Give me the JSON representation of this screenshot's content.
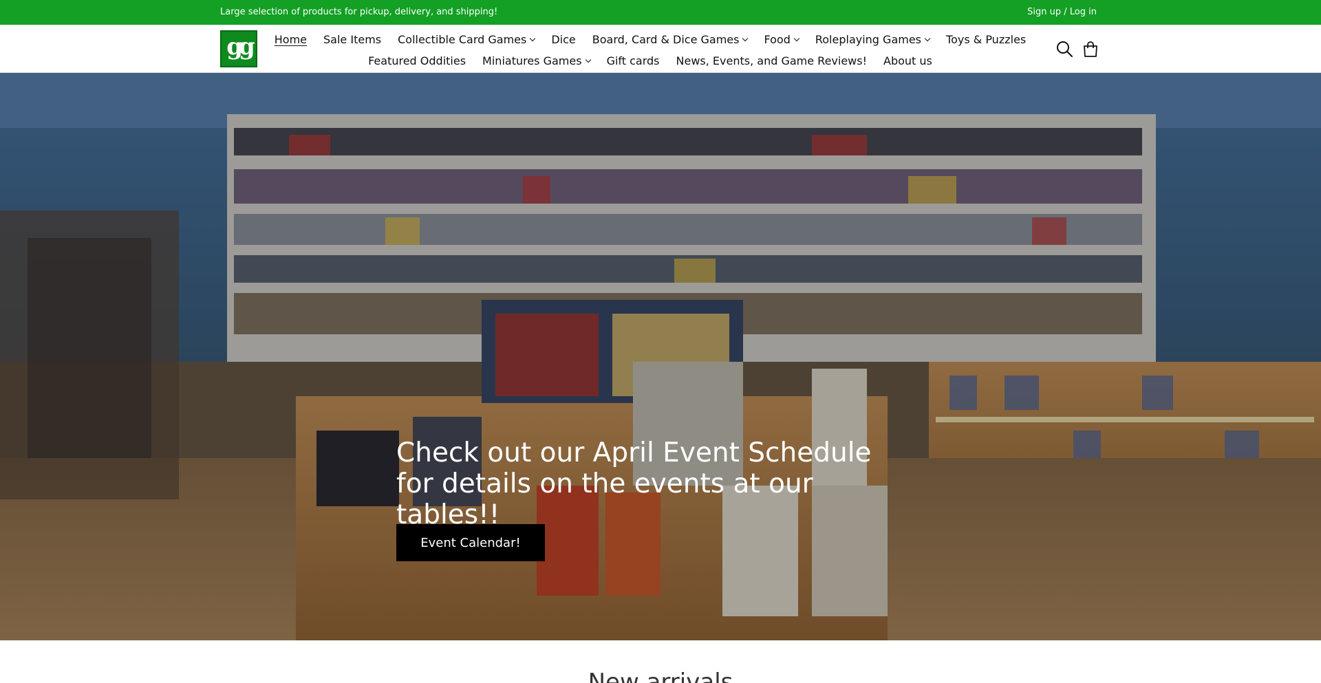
{
  "announcement": {
    "text": "Large selection of products for pickup, delivery, and shipping!",
    "account_link": "Sign up / Log in"
  },
  "logo": {
    "mark": "gg"
  },
  "nav": {
    "row1": [
      {
        "label": "Home",
        "dropdown": false,
        "active": true
      },
      {
        "label": "Sale Items",
        "dropdown": false
      },
      {
        "label": "Collectible Card Games",
        "dropdown": true
      },
      {
        "label": "Dice",
        "dropdown": false
      },
      {
        "label": "Board, Card & Dice Games",
        "dropdown": true
      },
      {
        "label": "Food",
        "dropdown": true
      },
      {
        "label": "Roleplaying Games",
        "dropdown": true
      },
      {
        "label": "Toys & Puzzles",
        "dropdown": false
      }
    ],
    "row2": [
      {
        "label": "Featured Oddities",
        "dropdown": false
      },
      {
        "label": "Miniatures Games",
        "dropdown": true
      },
      {
        "label": "Gift cards",
        "dropdown": false
      },
      {
        "label": "News, Events, and Game Reviews!",
        "dropdown": false
      },
      {
        "label": "About us",
        "dropdown": false
      }
    ]
  },
  "header_icons": [
    "search-icon",
    "shopping-bag-icon"
  ],
  "hero": {
    "heading": "Check out our April Event Schedule for details on the events at our tables!!",
    "button_label": "Event Calendar!"
  },
  "next_section": {
    "title": "New arrivals"
  },
  "colors": {
    "announcement_bg": "#13a024",
    "logo_green": "#0e8a1e",
    "button_bg": "#000000"
  }
}
